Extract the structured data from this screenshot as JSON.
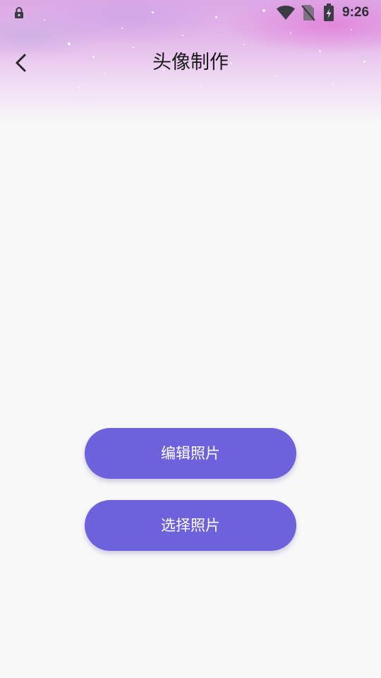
{
  "status_bar": {
    "time": "9:26",
    "icons": [
      "lock-icon",
      "wifi-icon",
      "no-sim-icon",
      "battery-charging-icon"
    ]
  },
  "header": {
    "back_icon": "chevron-left-icon",
    "title": "头像制作"
  },
  "actions": {
    "edit_photo": "编辑照片",
    "select_photo": "选择照片"
  },
  "colors": {
    "button": "#6e62dc",
    "button_text": "#ffffff",
    "background": "#f8f8f9",
    "header_gradient_pink": "#e27cd6",
    "header_gradient_lavender": "#dcb8ec",
    "title_text": "#1a1a1a"
  }
}
